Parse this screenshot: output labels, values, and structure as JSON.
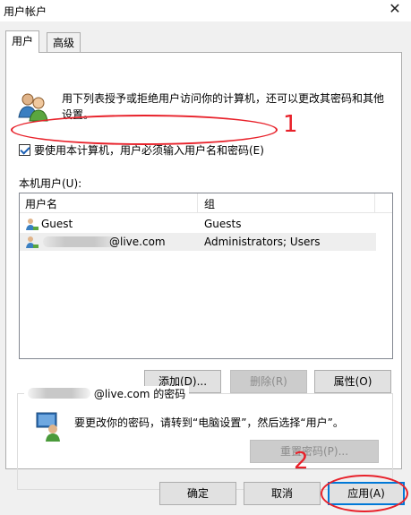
{
  "window": {
    "title": "用户帐户",
    "close_glyph": "✕"
  },
  "tabs": [
    {
      "label": "用户",
      "active": true
    },
    {
      "label": "高级",
      "active": false
    }
  ],
  "description": "用下列表授予或拒绝用户访问你的计算机，还可以更改其密码和其他设置。",
  "require_password": {
    "label": "要使用本计算机，用户必须输入用户名和密码(E)",
    "checked": true
  },
  "list": {
    "label": "本机用户(U):",
    "columns": [
      "用户名",
      "组"
    ],
    "rows": [
      {
        "name": "Guest",
        "group": "Guests"
      },
      {
        "name": "@live.com",
        "group": "Administrators; Users"
      }
    ]
  },
  "list_buttons": {
    "add": "添加(D)...",
    "remove": "删除(R)",
    "properties": "属性(O)"
  },
  "password_group": {
    "title": "@live.com 的密码",
    "text": "要更改你的密码，请转到“电脑设置”，然后选择“用户”。",
    "reset_button": "重置密码(P)..."
  },
  "dialog_buttons": {
    "ok": "确定",
    "cancel": "取消",
    "apply": "应用(A)"
  },
  "annotations": {
    "one": "1",
    "two": "2",
    "color": "#e8212a"
  },
  "colors": {
    "accent": "#0078d7",
    "dialog_bg": "#f0f0f0"
  }
}
